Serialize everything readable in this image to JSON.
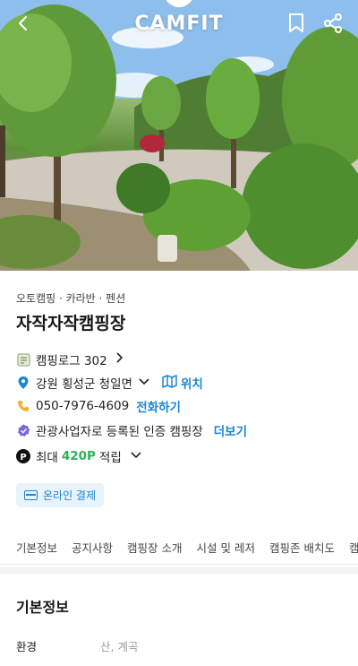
{
  "header": {
    "logo": "CAMFIT",
    "icons": [
      "back-arrow-icon",
      "bookmark-icon",
      "share-icon"
    ]
  },
  "campsite": {
    "category": "오토캠핑 · 카라반 · 펜션",
    "name": "자작자작캠핑장",
    "camping_log": "캠핑로그 302",
    "location": "강원 횡성군 청일면",
    "map_link": "위치",
    "phone": "050-7976-4609",
    "call_link": "전화하기",
    "certification": "관광사업자로 등록된 인증 캠핑장",
    "more_link": "더보기",
    "points_prefix": "최대",
    "points_value": "420P",
    "points_suffix": "적립"
  },
  "payment_badge": "온라인 결제",
  "tabs": [
    "기본정보",
    "공지사항",
    "캠핑장 소개",
    "시설 및 레저",
    "캠핑존 배치도",
    "캠"
  ],
  "basic_info": {
    "title": "기본정보",
    "environment_label": "환경",
    "environment_value": "산, 계곡"
  },
  "colors": {
    "accent_blue": "#1a86d6",
    "points_green": "#2bb35a",
    "chip_bg": "#e8f3fc"
  }
}
